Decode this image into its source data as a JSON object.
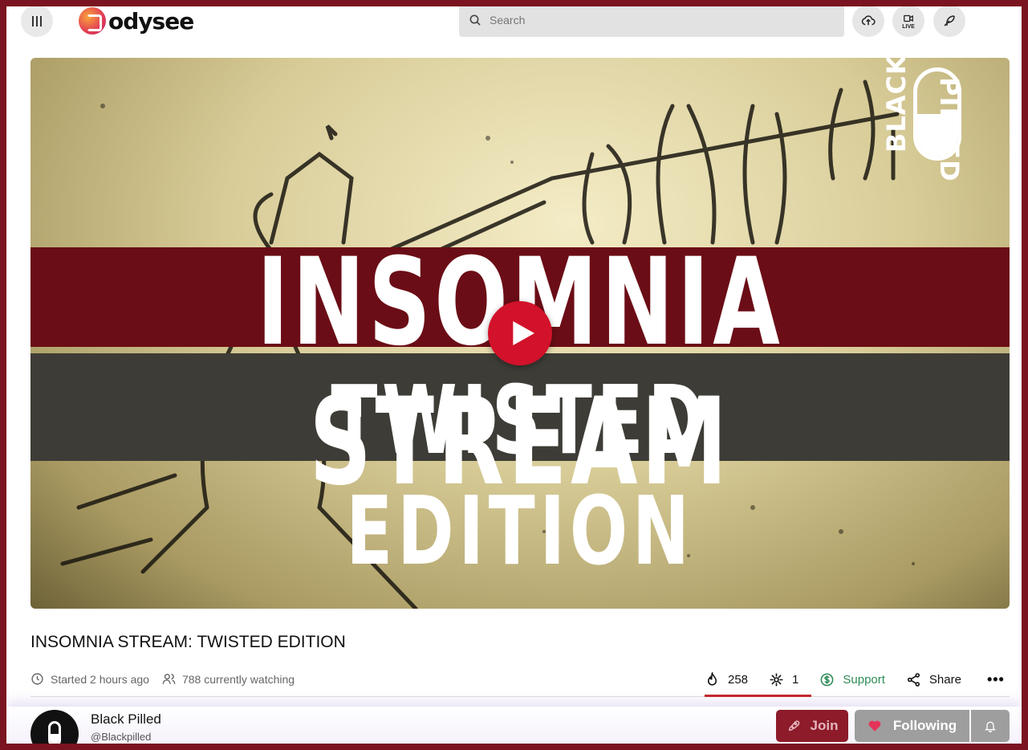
{
  "header": {
    "logo_text": "odysee",
    "search_placeholder": "Search",
    "live_label": "LIVE"
  },
  "video": {
    "headline_line1": "INSOMNIA STREAM",
    "headline_line2": "TWISTED EDITION",
    "badge_left": "BLACK",
    "badge_right": "PILLED"
  },
  "content": {
    "title": "INSOMNIA STREAM: TWISTED EDITION",
    "started": "Started 2 hours ago",
    "watching": "788 currently watching"
  },
  "actions": {
    "fire_count": "258",
    "slime_count": "1",
    "support_label": "Support",
    "share_label": "Share",
    "more_label": "•••"
  },
  "channel": {
    "name": "Black Pilled",
    "handle": "@Blackpilled",
    "join_label": "Join",
    "follow_label": "Following"
  },
  "colors": {
    "frame": "#7a1420",
    "play": "#d2122a",
    "support": "#2e8b57",
    "join_bg": "#8d1b2a",
    "follow_bg": "#9e9e9e"
  }
}
